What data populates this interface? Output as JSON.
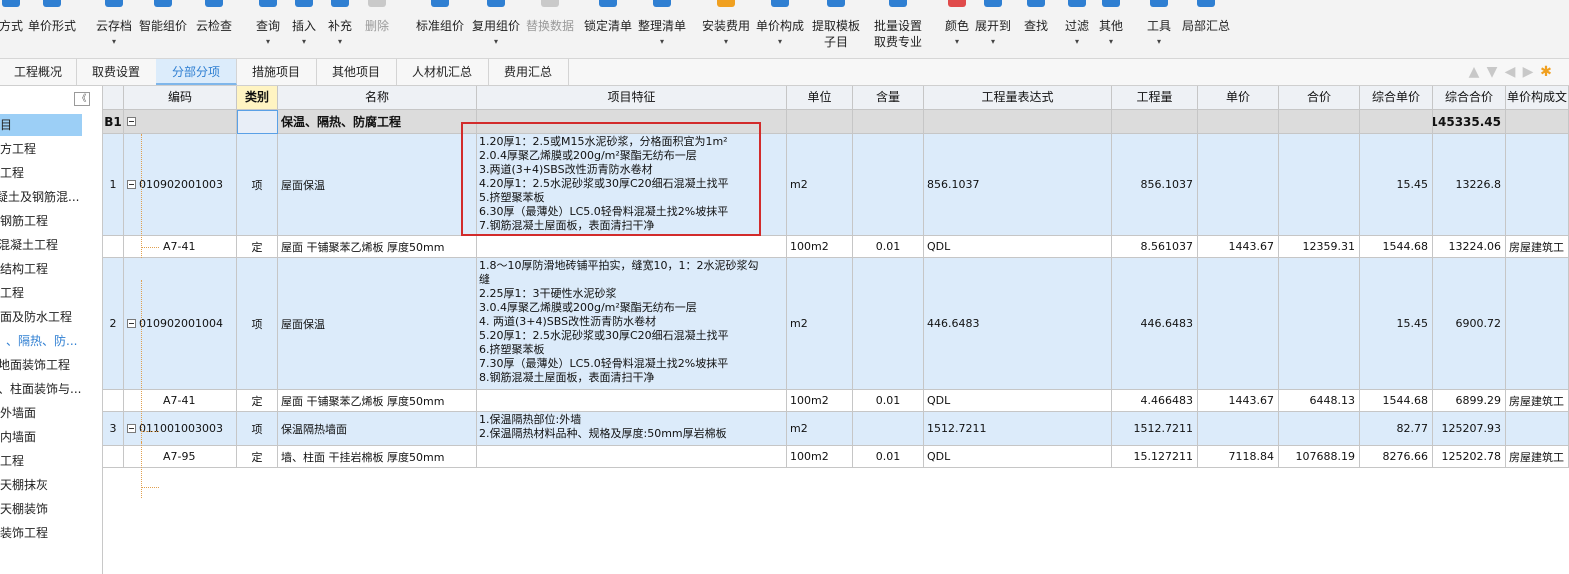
{
  "toolbar": {
    "items": [
      {
        "label": "方式",
        "icon": "cut-off-icon",
        "dropdown": false,
        "disabled": false
      },
      {
        "label": "单价形式",
        "icon": "price-mode-icon",
        "dropdown": false,
        "disabled": false
      },
      {
        "label": "云存档",
        "icon": "cloud-save-icon",
        "dropdown": true,
        "disabled": false
      },
      {
        "label": "智能组价",
        "icon": "smart-pricing-icon",
        "dropdown": false,
        "disabled": false
      },
      {
        "label": "云检查",
        "icon": "cloud-check-icon",
        "dropdown": false,
        "disabled": false
      },
      {
        "label": "查询",
        "icon": "query-icon",
        "dropdown": true,
        "disabled": false
      },
      {
        "label": "插入",
        "icon": "insert-icon",
        "dropdown": true,
        "disabled": false
      },
      {
        "label": "补充",
        "icon": "supplement-icon",
        "dropdown": true,
        "disabled": false
      },
      {
        "label": "删除",
        "icon": "delete-icon",
        "dropdown": false,
        "disabled": true
      },
      {
        "label": "标准组价",
        "icon": "standard-pricing-icon",
        "dropdown": false,
        "disabled": false
      },
      {
        "label": "复用组价",
        "icon": "reuse-pricing-icon",
        "dropdown": true,
        "disabled": false
      },
      {
        "label": "替换数据",
        "icon": "replace-data-icon",
        "dropdown": false,
        "disabled": true
      },
      {
        "label": "锁定清单",
        "icon": "lock-list-icon",
        "dropdown": false,
        "disabled": false
      },
      {
        "label": "整理清单",
        "icon": "organize-list-icon",
        "dropdown": true,
        "disabled": false
      },
      {
        "label": "安装费用",
        "icon": "install-fee-icon",
        "dropdown": true,
        "disabled": false
      },
      {
        "label": "单价构成",
        "icon": "unit-price-composition-icon",
        "dropdown": true,
        "disabled": false
      },
      {
        "label": "提取模板",
        "label2": "子目",
        "icon": "extract-template-icon",
        "dropdown": false,
        "disabled": false
      },
      {
        "label": "批量设置",
        "label2": "取费专业",
        "icon": "batch-setting-icon",
        "dropdown": false,
        "disabled": false
      },
      {
        "label": "颜色",
        "icon": "color-icon",
        "dropdown": true,
        "disabled": false
      },
      {
        "label": "展开到",
        "icon": "expand-to-icon",
        "dropdown": true,
        "disabled": false
      },
      {
        "label": "查找",
        "icon": "find-icon",
        "dropdown": false,
        "disabled": false
      },
      {
        "label": "过滤",
        "icon": "filter-icon",
        "dropdown": true,
        "disabled": false
      },
      {
        "label": "其他",
        "icon": "other-icon",
        "dropdown": true,
        "disabled": false
      },
      {
        "label": "工具",
        "icon": "tools-icon",
        "dropdown": true,
        "disabled": false
      },
      {
        "label": "局部汇总",
        "icon": "partial-summary-icon",
        "dropdown": false,
        "disabled": false
      }
    ]
  },
  "tabs": [
    {
      "label": "工程概况",
      "active": false
    },
    {
      "label": "取费设置",
      "active": false
    },
    {
      "label": "分部分项",
      "active": true
    },
    {
      "label": "措施项目",
      "active": false
    },
    {
      "label": "其他项目",
      "active": false
    },
    {
      "label": "人材机汇总",
      "active": false
    },
    {
      "label": "费用汇总",
      "active": false
    }
  ],
  "tree": {
    "collapse_symbol": "《",
    "items": [
      {
        "label": "目",
        "selected": true,
        "highlight": false
      },
      {
        "label": "方工程",
        "selected": false,
        "highlight": false
      },
      {
        "label": "工程",
        "selected": false,
        "highlight": false
      },
      {
        "label": "疑土及钢筋混...",
        "selected": false,
        "highlight": false
      },
      {
        "label": "钢筋工程",
        "selected": false,
        "highlight": false
      },
      {
        "label": "混凝土工程",
        "selected": false,
        "highlight": false
      },
      {
        "label": "结构工程",
        "selected": false,
        "highlight": false
      },
      {
        "label": "工程",
        "selected": false,
        "highlight": false
      },
      {
        "label": "面及防水工程",
        "selected": false,
        "highlight": false
      },
      {
        "label": "、隔热、防...",
        "selected": false,
        "highlight": true
      },
      {
        "label": "地面装饰工程",
        "selected": false,
        "highlight": false
      },
      {
        "label": "、柱面装饰与...",
        "selected": false,
        "highlight": false
      },
      {
        "label": "外墙面",
        "selected": false,
        "highlight": false
      },
      {
        "label": "内墙面",
        "selected": false,
        "highlight": false
      },
      {
        "label": "工程",
        "selected": false,
        "highlight": false
      },
      {
        "label": "天棚抹灰",
        "selected": false,
        "highlight": false
      },
      {
        "label": "天棚装饰",
        "selected": false,
        "highlight": false
      },
      {
        "label": "装饰工程",
        "selected": false,
        "highlight": false
      }
    ]
  },
  "grid": {
    "columns": [
      "",
      "编码",
      "类别",
      "名称",
      "项目特征",
      "单位",
      "含量",
      "工程量表达式",
      "工程量",
      "单价",
      "合价",
      "综合单价",
      "综合合价",
      "单价构成文"
    ],
    "section": {
      "no": "B1",
      "name": "保温、隔热、防腐工程",
      "total": "145335.45"
    },
    "rows": [
      {
        "kind": "item",
        "no": "1",
        "code": "010902001003",
        "type": "项",
        "name": "屋面保温",
        "features": "1.20厚1：2.5或M15水泥砂浆，分格面积宜为1m²\n2.0.4厚聚乙烯膜或200g/m²聚酯无纺布一层\n3.两道(3+4)SBS改性沥青防水卷材\n4.20厚1：2.5水泥砂浆或30厚C20细石混凝土找平\n5.挤塑聚苯板\n6.30厚（最薄处）LC5.0轻骨料混凝土找2%坡抹平\n7.钢筋混凝土屋面板，表面清扫干净",
        "unit": "m2",
        "content": "",
        "expr": "856.1037",
        "qty": "856.1037",
        "price": "",
        "amount": "",
        "comp_price": "15.45",
        "comp_amount": "13226.8",
        "composition": ""
      },
      {
        "kind": "sub",
        "no": "",
        "code": "A7-41",
        "type": "定",
        "name": "屋面 干铺聚苯乙烯板 厚度50mm",
        "features": "",
        "unit": "100m2",
        "content": "0.01",
        "expr": "QDL",
        "qty": "8.561037",
        "price": "1443.67",
        "amount": "12359.31",
        "comp_price": "1544.68",
        "comp_amount": "13224.06",
        "composition": "房屋建筑工"
      },
      {
        "kind": "item",
        "no": "2",
        "code": "010902001004",
        "type": "项",
        "name": "屋面保温",
        "features": "1.8～10厚防滑地砖铺平拍实，缝宽10，1：2水泥砂浆勾\n缝\n2.25厚1：3干硬性水泥砂浆\n3.0.4厚聚乙烯膜或200g/m²聚酯无纺布一层\n4. 两道(3+4)SBS改性沥青防水卷材\n5.20厚1：2.5水泥砂浆或30厚C20细石混凝土找平\n6.挤塑聚苯板\n7.30厚（最薄处）LC5.0轻骨料混凝土找2%坡抹平\n8.钢筋混凝土屋面板，表面清扫干净",
        "unit": "m2",
        "content": "",
        "expr": "446.6483",
        "qty": "446.6483",
        "price": "",
        "amount": "",
        "comp_price": "15.45",
        "comp_amount": "6900.72",
        "composition": ""
      },
      {
        "kind": "sub",
        "no": "",
        "code": "A7-41",
        "type": "定",
        "name": "屋面 干铺聚苯乙烯板 厚度50mm",
        "features": "",
        "unit": "100m2",
        "content": "0.01",
        "expr": "QDL",
        "qty": "4.466483",
        "price": "1443.67",
        "amount": "6448.13",
        "comp_price": "1544.68",
        "comp_amount": "6899.29",
        "composition": "房屋建筑工"
      },
      {
        "kind": "item",
        "no": "3",
        "code": "011001003003",
        "type": "项",
        "name": "保温隔热墙面",
        "features": "1.保温隔热部位:外墙\n2.保温隔热材料品种、规格及厚度:50mm厚岩棉板",
        "unit": "m2",
        "content": "",
        "expr": "1512.7211",
        "qty": "1512.7211",
        "price": "",
        "amount": "",
        "comp_price": "82.77",
        "comp_amount": "125207.93",
        "composition": ""
      },
      {
        "kind": "sub",
        "no": "",
        "code": "A7-95",
        "type": "定",
        "name": "墙、柱面 干挂岩棉板 厚度50mm",
        "features": "",
        "unit": "100m2",
        "content": "0.01",
        "expr": "QDL",
        "qty": "15.127211",
        "price": "7118.84",
        "amount": "107688.19",
        "comp_price": "8276.66",
        "comp_amount": "125202.78",
        "composition": "房屋建筑工"
      }
    ]
  }
}
